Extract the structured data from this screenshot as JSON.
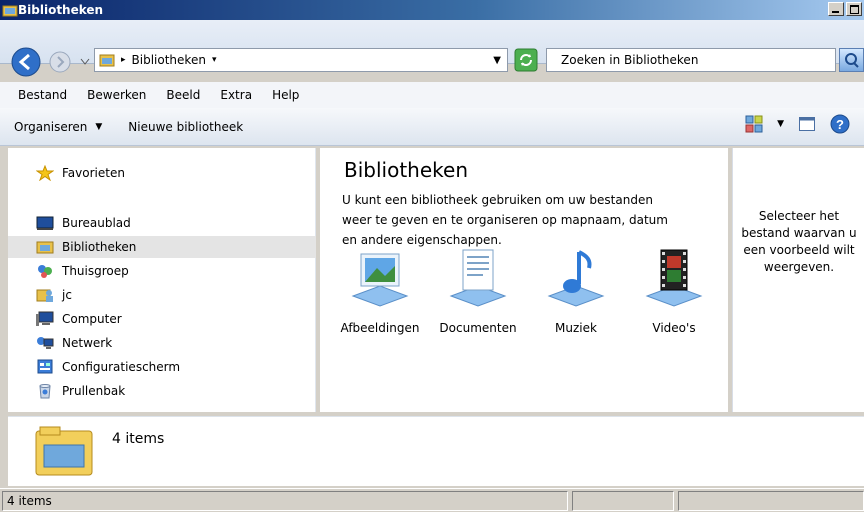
{
  "window": {
    "title": "Bibliotheken"
  },
  "address": {
    "crumb": "Bibliotheken"
  },
  "search": {
    "placeholder": "Zoeken in Bibliotheken"
  },
  "menu": [
    "Bestand",
    "Bewerken",
    "Beeld",
    "Extra",
    "Help"
  ],
  "commands": {
    "organize": "Organiseren",
    "new_library": "Nieuwe bibliotheek"
  },
  "nav": {
    "favorites": "Favorieten",
    "items": [
      {
        "label": "Bureaublad",
        "icon": "desktop-icon"
      },
      {
        "label": "Bibliotheken",
        "icon": "library-icon",
        "selected": true
      },
      {
        "label": "Thuisgroep",
        "icon": "homegroup-icon"
      },
      {
        "label": "jc",
        "icon": "user-folder-icon"
      },
      {
        "label": "Computer",
        "icon": "computer-icon"
      },
      {
        "label": "Netwerk",
        "icon": "network-icon"
      },
      {
        "label": "Configuratiescherm",
        "icon": "control-panel-icon"
      },
      {
        "label": "Prullenbak",
        "icon": "recycle-bin-icon"
      }
    ]
  },
  "main": {
    "heading": "Bibliotheken",
    "description": "U kunt een bibliotheek gebruiken om uw bestanden weer te geven en te organiseren op mapnaam, datum en andere eigenschappen.",
    "libraries": [
      {
        "label": "Afbeeldingen",
        "icon": "pictures-library-icon"
      },
      {
        "label": "Documenten",
        "icon": "documents-library-icon"
      },
      {
        "label": "Muziek",
        "icon": "music-library-icon"
      },
      {
        "label": "Video's",
        "icon": "videos-library-icon"
      }
    ]
  },
  "preview": {
    "message": "Selecteer het bestand waarvan u een voorbeeld wilt weergeven."
  },
  "details": {
    "count": "4 items"
  },
  "status": {
    "text": "4 items"
  }
}
